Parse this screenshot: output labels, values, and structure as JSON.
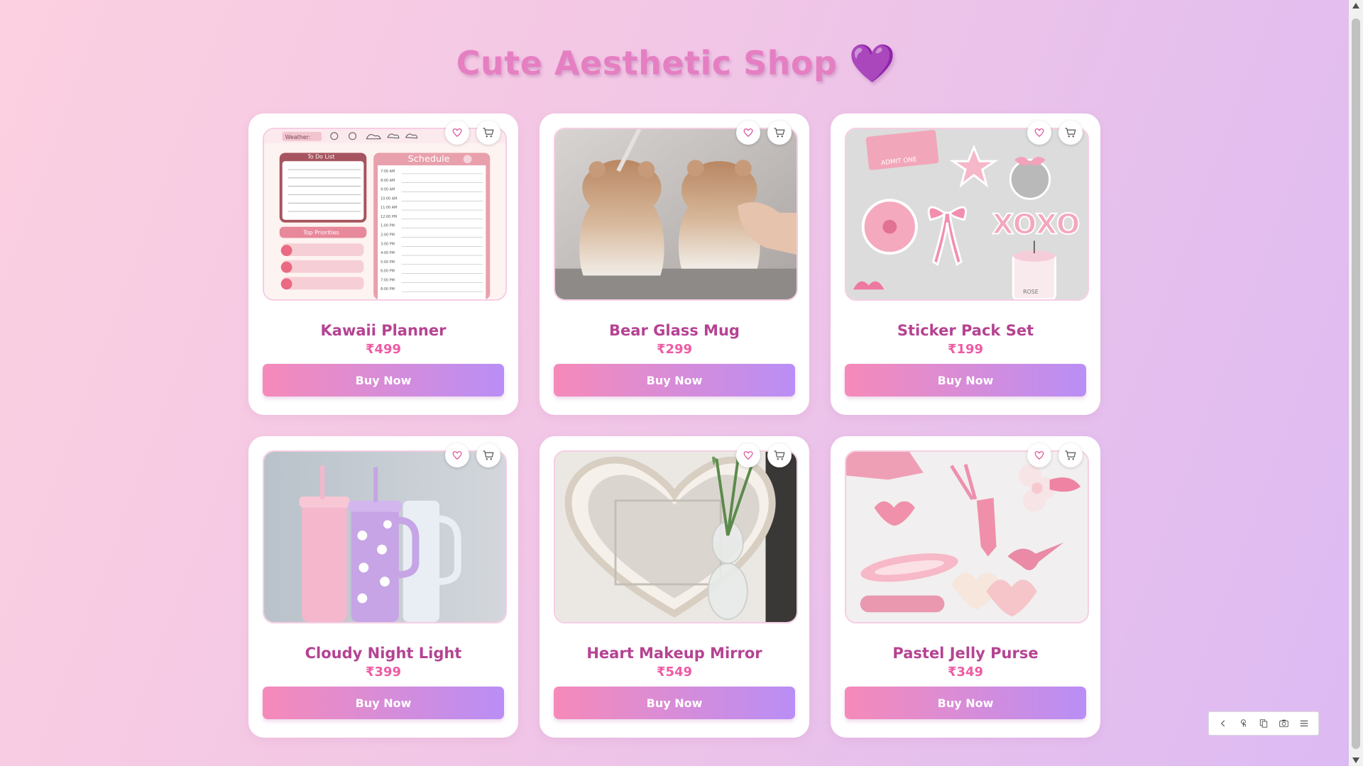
{
  "page": {
    "title": "Cute Aesthetic Shop",
    "title_icon": "purple-heart-icon"
  },
  "colors": {
    "title": "#e57fc2",
    "product_name": "#b54392",
    "price": "#ee5ba4",
    "button_gradient_start": "#f68ab9",
    "button_gradient_end": "#b98ef6"
  },
  "products": [
    {
      "name": "Kawaii Planner",
      "price": "₹499",
      "button": "Buy Now",
      "image": "kawaii-planner-image",
      "fav_icon": "heart-outline-icon",
      "cart_icon": "cart-icon"
    },
    {
      "name": "Bear Glass Mug",
      "price": "₹299",
      "button": "Buy Now",
      "image": "bear-glass-mug-image",
      "fav_icon": "heart-outline-icon",
      "cart_icon": "cart-icon"
    },
    {
      "name": "Sticker Pack Set",
      "price": "₹199",
      "button": "Buy Now",
      "image": "sticker-pack-image",
      "fav_icon": "heart-outline-icon",
      "cart_icon": "cart-icon"
    },
    {
      "name": "Cloudy Night Light",
      "price": "₹399",
      "button": "Buy Now",
      "image": "cloudy-night-light-image",
      "fav_icon": "heart-outline-icon",
      "cart_icon": "cart-icon"
    },
    {
      "name": "Heart Makeup Mirror",
      "price": "₹549",
      "button": "Buy Now",
      "image": "heart-makeup-mirror-image",
      "fav_icon": "heart-outline-icon",
      "cart_icon": "cart-icon"
    },
    {
      "name": "Pastel Jelly Purse",
      "price": "₹349",
      "button": "Buy Now",
      "image": "pastel-jelly-purse-image",
      "fav_icon": "heart-outline-icon",
      "cart_icon": "cart-icon"
    }
  ],
  "planner_image": {
    "weather_label": "Weather:",
    "todo_label": "To Do List",
    "schedule_label": "Schedule",
    "priorities_label": "Top Priorities",
    "times": [
      "7:00 AM",
      "8:00 AM",
      "9:00 AM",
      "10:00 AM",
      "11:00 AM",
      "12:00 PM",
      "1:00 PM",
      "2:00 PM",
      "3:00 PM",
      "4:00 PM",
      "5:00 PM",
      "6:00 PM",
      "7:00 PM",
      "8:00 PM"
    ]
  },
  "sticker_image": {
    "ticket_text": "ADMIT ONE",
    "xoxo_text": "XOXO",
    "candle_text": "ROSE"
  },
  "toolbar": {
    "icons": [
      "back-icon",
      "touch-icon",
      "copy-icon",
      "camera-icon",
      "menu-icon"
    ]
  }
}
